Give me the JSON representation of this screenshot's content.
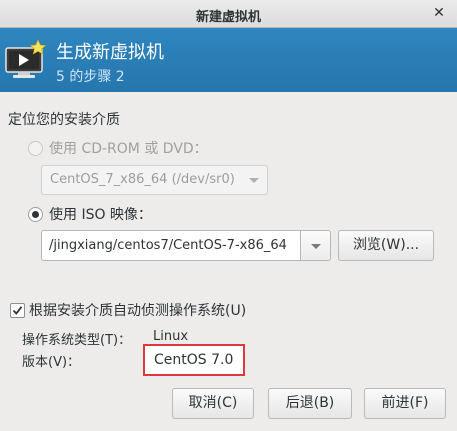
{
  "window": {
    "title": "新建虚拟机"
  },
  "banner": {
    "heading": "生成新虚拟机",
    "step": "5 的步骤 2"
  },
  "media": {
    "section_label": "定位您的安装介质",
    "cdrom_option": "使用  CD-ROM 或  DVD：",
    "cdrom_device": "CentOS_7_x86_64 (/dev/sr0)",
    "iso_option": "使用  ISO 映像：",
    "iso_path": "/jingxiang/centos7/CentOS-7-x86_64",
    "browse_label": "浏览(W)..."
  },
  "detect": {
    "checkbox_label": "根据安装介质自动侦测操作系统(U)",
    "checked": true,
    "os_type_label": "操作系统类型(T)：",
    "os_type_value": "Linux",
    "version_label": "版本(V)：",
    "version_value": "CentOS 7.0",
    "highlight_color": "#e0383e"
  },
  "buttons": {
    "cancel": "取消(C)",
    "back": "后退(B)",
    "forward": "前进(F)"
  },
  "colors": {
    "banner": "#2980b9"
  }
}
